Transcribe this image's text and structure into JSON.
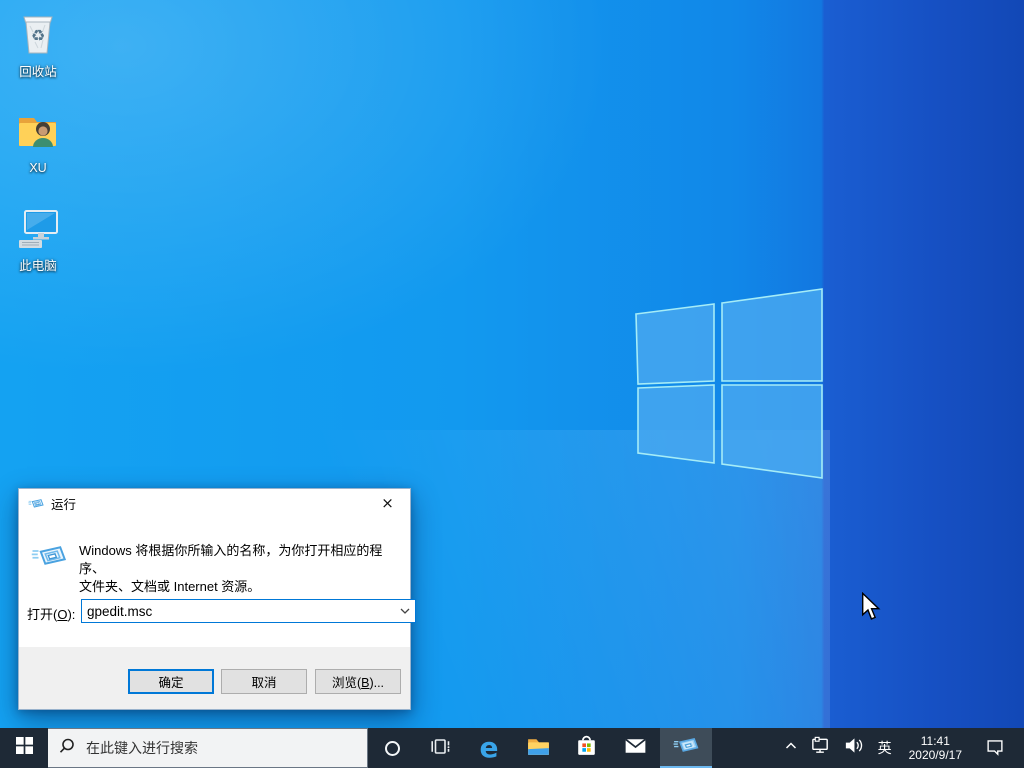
{
  "desktop": {
    "icons": [
      {
        "id": "recycle-bin",
        "label": "回收站"
      },
      {
        "id": "user-folder",
        "label": "XU"
      },
      {
        "id": "this-pc",
        "label": "此电脑"
      }
    ]
  },
  "run_dialog": {
    "title": "运行",
    "close_glyph": "×",
    "description_line1": "Windows 将根据你所输入的名称，为你打开相应的程序、",
    "description_line2": "文件夹、文档或 Internet 资源。",
    "open_label_prefix": "打开(",
    "open_label_key": "O",
    "open_label_suffix": "):",
    "open_value": "gpedit.msc",
    "ok_label": "确定",
    "cancel_label": "取消",
    "browse_label_prefix": "浏览(",
    "browse_label_key": "B",
    "browse_label_suffix": ")..."
  },
  "taskbar": {
    "search_placeholder": "在此键入进行搜索",
    "active_app": "run",
    "tray": {
      "ime_label": "英",
      "time": "11:41",
      "date": "2020/9/17"
    }
  },
  "colors": {
    "accent": "#0078d7",
    "taskbar_bg": "#1e2936",
    "taskbar_active_underline": "#6cb8f0",
    "wallpaper_left": "#1299ef",
    "wallpaper_right": "#164fc2"
  }
}
